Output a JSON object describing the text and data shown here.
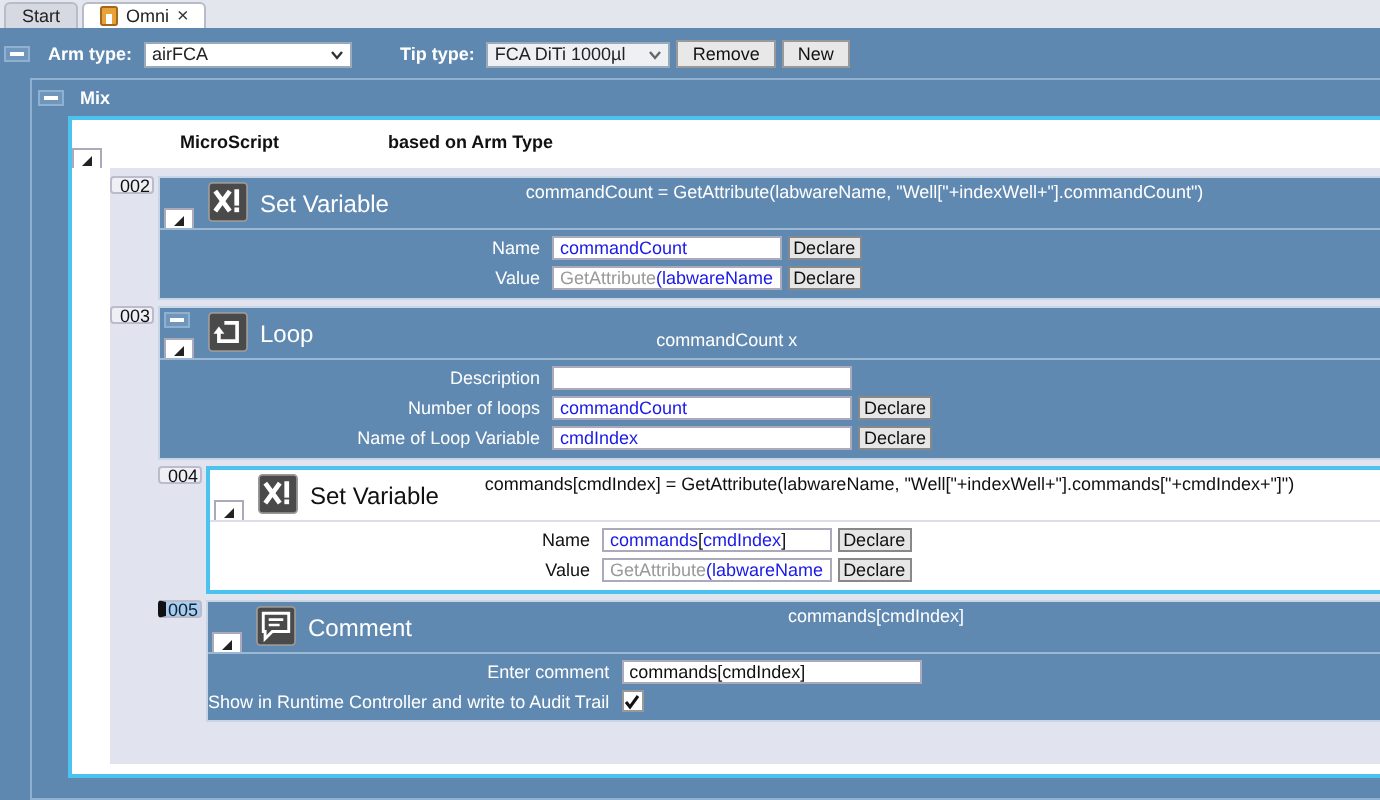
{
  "tabs": [
    {
      "label": "Start",
      "selected": false
    },
    {
      "label": "Omni",
      "selected": true,
      "close": "×"
    }
  ],
  "toolbar": {
    "arm_type": {
      "label": "Arm type:",
      "value": "airFCA"
    },
    "tip_type": {
      "label": "Tip type:",
      "value": "FCA DiTi 1000µl"
    },
    "buttons": [
      "Remove",
      "New"
    ]
  },
  "mix": {
    "title": "Mix",
    "expanded": true,
    "columns": [
      "MicroScript",
      "based on Arm Type"
    ],
    "steps": [
      {
        "number": "002",
        "number_selected": false,
        "expanded": true,
        "kind": "set_variable",
        "title": "Set Variable",
        "selected": false,
        "expression": "commandCount = GetAttribute(labwareName, \"Well[\"+indexWell+\"].commandCount\")",
        "fields": [
          {
            "kind": "text",
            "label": "Name",
            "parts": [
              {
                "text": "commandCount",
                "kind": "variable"
              }
            ],
            "declare": "Declare"
          },
          {
            "kind": "text",
            "label": "Value",
            "parts": [
              {
                "text": "GetAttribute",
                "kind": "function"
              },
              {
                "text": "(labwareName",
                "kind": "variable"
              }
            ],
            "declare": "Declare"
          }
        ]
      },
      {
        "number": "003",
        "number_selected": false,
        "expanded": true,
        "kind": "loop",
        "title": "Loop",
        "selected": false,
        "expression": "commandCount x",
        "fields": [
          {
            "kind": "text",
            "label": "Description",
            "wide": true
          },
          {
            "kind": "text",
            "label": "Number of loops",
            "parts": [
              {
                "text": "commandCount",
                "kind": "variable"
              }
            ],
            "declare": "Declare"
          },
          {
            "kind": "text",
            "label": "Name of Loop Variable",
            "parts": [
              {
                "text": "cmdIndex",
                "kind": "variable"
              }
            ],
            "declare": "Declare"
          }
        ],
        "children": [
          {
            "number": "004",
            "number_selected": false,
            "expanded": true,
            "kind": "set_variable",
            "title": "Set Variable",
            "selected": true,
            "expression": "commands[cmdIndex] = GetAttribute(labwareName, \"Well[\"+indexWell+\"].commands[\"+cmdIndex+\"]\")",
            "fields": [
              {
                "kind": "text",
                "label": "Name",
                "parts": [
                  {
                    "text": "commands",
                    "kind": "variable"
                  },
                  {
                    "text": "[",
                    "kind": "plain"
                  },
                  {
                    "text": "cmdIndex",
                    "kind": "variable"
                  },
                  {
                    "text": "]",
                    "kind": "plain"
                  }
                ],
                "declare": "Declare"
              },
              {
                "kind": "text",
                "label": "Value",
                "parts": [
                  {
                    "text": "GetAttribute",
                    "kind": "function"
                  },
                  {
                    "text": "(labwareName",
                    "kind": "variable"
                  }
                ],
                "declare": "Declare"
              }
            ]
          },
          {
            "number": "005",
            "number_selected": true,
            "expanded": true,
            "kind": "comment",
            "title": "Comment",
            "selected": false,
            "expression": "commands[cmdIndex]",
            "fields": [
              {
                "kind": "text",
                "label": "Enter comment",
                "wide": true,
                "parts": [
                  {
                    "text": "commands[cmdIndex]",
                    "kind": "plain"
                  }
                ]
              },
              {
                "kind": "checkbox",
                "label": "Show in Runtime Controller and write to Audit Trail",
                "checked": true
              }
            ]
          }
        ]
      }
    ]
  }
}
